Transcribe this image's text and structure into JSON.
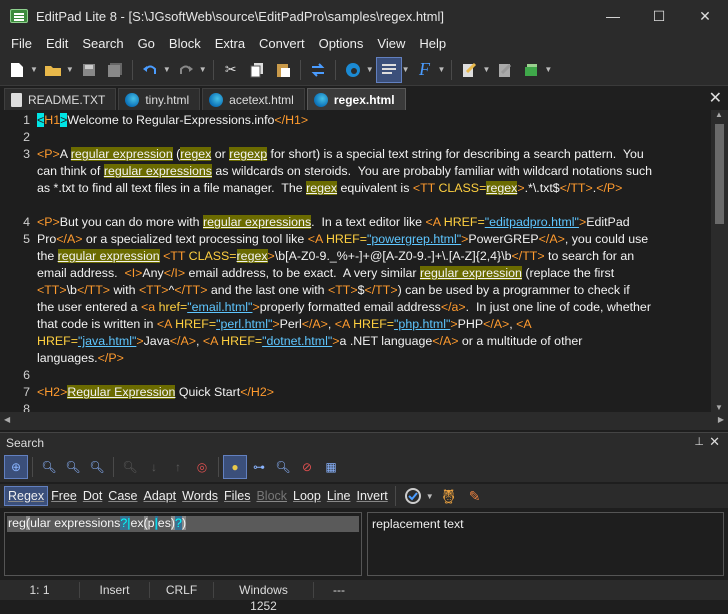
{
  "window": {
    "title": "EditPad Lite 8 - [S:\\JGsoftWeb\\source\\EditPadPro\\samples\\regex.html]",
    "minimize": "—",
    "maximize": "☐",
    "close": "✕"
  },
  "menu": [
    "File",
    "Edit",
    "Search",
    "Go",
    "Block",
    "Extra",
    "Convert",
    "Options",
    "View",
    "Help"
  ],
  "tabs": [
    {
      "label": "README.TXT",
      "icon": "text-file-icon",
      "active": false
    },
    {
      "label": "tiny.html",
      "icon": "edge-icon",
      "active": false
    },
    {
      "label": "acetext.html",
      "icon": "edge-icon",
      "active": false
    },
    {
      "label": "regex.html",
      "icon": "edge-icon",
      "active": true
    }
  ],
  "line_numbers": [
    "1",
    "2",
    "3",
    "",
    "",
    "4",
    "5",
    "",
    "",
    "",
    "",
    "",
    "",
    "",
    "",
    "6",
    "7",
    "8"
  ],
  "search": {
    "title": "Search",
    "options": [
      {
        "label": "Regex",
        "on": true
      },
      {
        "label": "Free",
        "on": false
      },
      {
        "label": "Dot",
        "on": false
      },
      {
        "label": "Case",
        "on": false
      },
      {
        "label": "Adapt",
        "on": false
      },
      {
        "label": "Words",
        "on": false
      },
      {
        "label": "Files",
        "on": false
      },
      {
        "label": "Block",
        "on": false,
        "dim": true
      },
      {
        "label": "Loop",
        "on": false
      },
      {
        "label": "Line",
        "on": false
      },
      {
        "label": "Invert",
        "on": false
      }
    ],
    "regex_parts": [
      "reg",
      "(",
      "ular",
      "",
      "expressions",
      "?",
      "|",
      "ex",
      "(",
      "p",
      "|",
      "es",
      ")",
      "?",
      ")"
    ],
    "replacement": "replacement text"
  },
  "status": {
    "position": "1: 1",
    "mode": "Insert",
    "line_break": "CRLF",
    "encoding": "Windows 1252",
    "extra": "---"
  },
  "colors": {
    "tag": "#ff9b2e",
    "highlight": "#6b6b00",
    "link": "#5ec6ff",
    "background": "#1e1e1e"
  }
}
